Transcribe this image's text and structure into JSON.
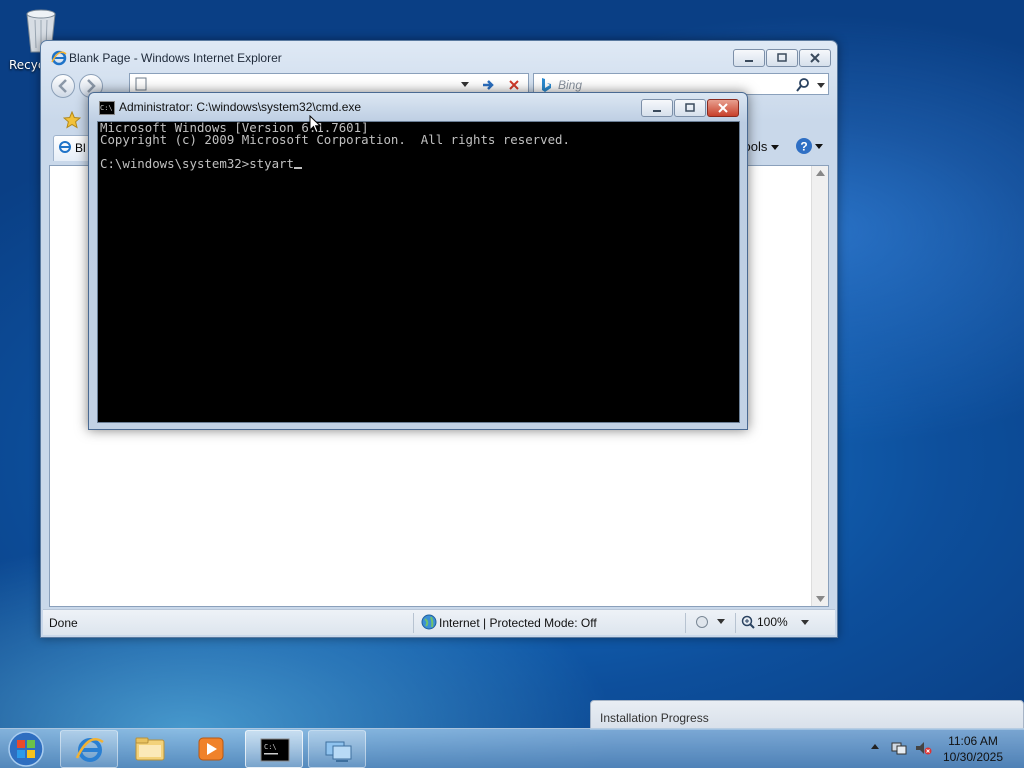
{
  "desktop": {
    "recycle_label": "Recyc"
  },
  "ie": {
    "title": "Blank Page - Windows Internet Explorer",
    "address_value": "",
    "search_placeholder": "Bing",
    "tab_label": "Bl",
    "tools_label": "Tools",
    "status_text": "Done",
    "zone_text": "Internet | Protected Mode: Off",
    "zoom_text": "100%"
  },
  "cmd": {
    "title": "Administrator: C:\\windows\\system32\\cmd.exe",
    "icon_text": "C:\\",
    "lines": [
      "Microsoft Windows [Version 6.1.7601]",
      "Copyright (c) 2009 Microsoft Corporation.  All rights reserved.",
      "",
      "C:\\windows\\system32>styart"
    ]
  },
  "notification": {
    "title": "Installation Progress"
  },
  "taskbar": {
    "time": "11:06 AM",
    "date": "10/30/2025"
  },
  "colors": {
    "console_bg": "#000000",
    "console_text": "#c0c0c0",
    "desktop_blue": "#1a78cf"
  }
}
